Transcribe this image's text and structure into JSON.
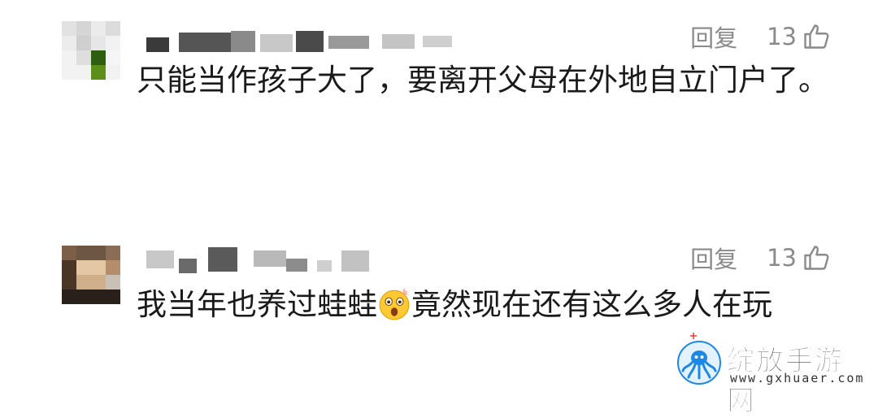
{
  "comments": [
    {
      "reply_label": "回复",
      "like_count": "13",
      "text": "只能当作孩子大了，要离开父母在外地自立门户了。"
    },
    {
      "reply_label": "回复",
      "like_count": "13",
      "text_before_emoji": "我当年也养过蛙蛙",
      "emoji": "astonished-emoji",
      "text_after_emoji": "竟然现在还有这么多人在玩"
    }
  ],
  "watermark": {
    "title": "绽放手游网",
    "url": "www.gxhuaer.com",
    "logo": "octopus-logo-icon"
  },
  "colors": {
    "secondary_text": "#8a8a8a",
    "body_text": "#1a1a1a",
    "watermark_blue": "#1e88e5"
  }
}
